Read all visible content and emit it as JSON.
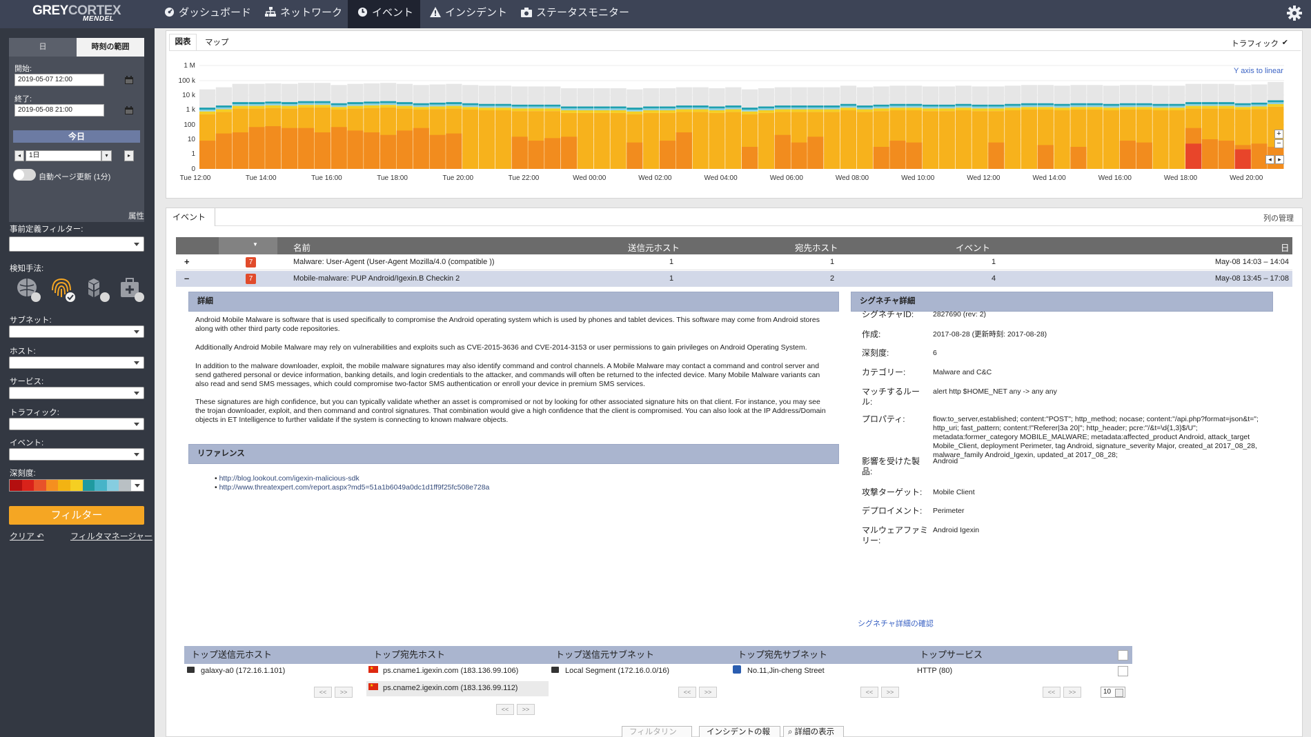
{
  "brand": {
    "name_a": "GREY",
    "name_b": "CORTEX",
    "sub": "MENDEL"
  },
  "nav": [
    {
      "label": "ダッシュボード",
      "icon": "dashboard-icon"
    },
    {
      "label": "ネットワーク",
      "icon": "network-icon"
    },
    {
      "label": "イベント",
      "icon": "clock-icon",
      "active": true
    },
    {
      "label": "インシデント",
      "icon": "warning-icon"
    },
    {
      "label": "ステータスモニター",
      "icon": "camera-icon"
    }
  ],
  "sidebar": {
    "seg_day": "日",
    "seg_range": "時刻の範囲",
    "start_label": "開始:",
    "start_value": "2019-05-07 12:00",
    "end_label": "終了:",
    "end_value": "2019-05-08 21:00",
    "today": "今日",
    "period_value": "1日",
    "auto_refresh": "自動ページ更新 (1分)",
    "attrs": "属性",
    "predef_filter": "事前定義フィルター:",
    "detection": "検知手法:",
    "subnet": "サブネット:",
    "host": "ホスト:",
    "service": "サービス:",
    "traffic": "トラフィック:",
    "event": "イベント:",
    "severity": "深刻度:",
    "severity_colors": [
      "#b40f0f",
      "#d9221a",
      "#e8522a",
      "#f58f1f",
      "#f3b312",
      "#f5cf22",
      "#1f9aa0",
      "#47b4c8",
      "#86cde0",
      "#b9c0c4"
    ],
    "filter_btn": "フィルター",
    "clear": "クリア",
    "filter_manager": "フィルタマネージャー"
  },
  "chart": {
    "tabs": [
      "図表",
      "マップ"
    ],
    "traffic_toggle": "トラフィック",
    "traffic_check": "✔",
    "yaxis_link": "Y axis to linear",
    "zoom_in": "+",
    "zoom_out": "−",
    "nav_prev": "◂",
    "nav_next": "▸",
    "chart_data": {
      "type": "bar",
      "yscale": "log",
      "ylabels": [
        "1 M",
        "100 k",
        "10 k",
        "1 k",
        "100",
        "10",
        "1",
        "0"
      ],
      "xlabels": [
        "Tue 12:00",
        "Tue 14:00",
        "Tue 16:00",
        "Tue 18:00",
        "Tue 20:00",
        "Tue 22:00",
        "Wed 00:00",
        "Wed 02:00",
        "Wed 04:00",
        "Wed 06:00",
        "Wed 08:00",
        "Wed 10:00",
        "Wed 12:00",
        "Wed 14:00",
        "Wed 16:00",
        "Wed 18:00",
        "Wed 20:00"
      ],
      "bins": 66,
      "grey_top": [
        25000,
        35000,
        60000,
        60000,
        65000,
        60000,
        70000,
        70000,
        50000,
        60000,
        65000,
        70000,
        60000,
        50000,
        55000,
        60000,
        50000,
        45000,
        45000,
        40000,
        40000,
        40000,
        30000,
        30000,
        30000,
        30000,
        25000,
        30000,
        30000,
        35000,
        35000,
        30000,
        35000,
        25000,
        30000,
        35000,
        35000,
        35000,
        35000,
        45000,
        35000,
        40000,
        45000,
        45000,
        40000,
        40000,
        45000,
        40000,
        40000,
        45000,
        50000,
        50000,
        45000,
        50000,
        50000,
        45000,
        50000,
        50000,
        45000,
        45000,
        60000,
        60000,
        60000,
        50000,
        55000,
        80000
      ],
      "dark_orange": [
        8,
        25,
        30,
        70,
        80,
        60,
        60,
        30,
        70,
        40,
        30,
        20,
        40,
        60,
        20,
        25,
        0,
        0,
        0,
        15,
        8,
        12,
        15,
        0,
        0,
        0,
        6,
        0,
        8,
        30,
        0,
        0,
        0,
        3,
        0,
        20,
        6,
        15,
        0,
        0,
        0,
        3,
        8,
        6,
        0,
        0,
        0,
        0,
        6,
        0,
        0,
        4,
        0,
        3,
        0,
        0,
        8,
        6,
        0,
        0,
        60,
        10,
        8,
        4,
        5,
        3
      ],
      "red": [
        0,
        0,
        0,
        0,
        0,
        0,
        0,
        0,
        0,
        0,
        0,
        0,
        0,
        0,
        0,
        0,
        0,
        0,
        0,
        0,
        0,
        0,
        0,
        0,
        0,
        0,
        0,
        0,
        0,
        0,
        0,
        0,
        0,
        0,
        0,
        0,
        0,
        0,
        0,
        0,
        0,
        0,
        0,
        0,
        0,
        0,
        0,
        0,
        0,
        0,
        0,
        0,
        0,
        0,
        0,
        0,
        0,
        0,
        0,
        0,
        5,
        0,
        0,
        2,
        0,
        0
      ]
    }
  },
  "events": {
    "tab": "イベント",
    "manage_cols": "列の管理",
    "columns": {
      "name": "名前",
      "src": "送信元ホスト",
      "dst": "宛先ホスト",
      "events": "イベント",
      "date": "日"
    },
    "rows": [
      {
        "expand": "+",
        "sev": "7",
        "name": "Malware: User-Agent (User-Agent Mozilla/4.0 (compatible ))",
        "src": "1",
        "dst": "1",
        "events": "1",
        "date": "May-08 14:03 – 14:04"
      },
      {
        "expand": "–",
        "sev": "7",
        "name": "Mobile-malware: PUP Android/Igexin.B Checkin 2",
        "src": "1",
        "dst": "2",
        "events": "4",
        "date": "May-08 13:45 – 17:08"
      }
    ],
    "detail_header": "詳細",
    "detail_paras": [
      "Android Mobile Malware is software that is used specifically to compromise the Android operating system which is used by phones and tablet devices. This software may come from Android stores along with other third party code repositories.",
      "Additionally Android Mobile Malware may rely on vulnerabilities and exploits such as CVE-2015-3636 and CVE-2014-3153 or user permissions to gain privileges on Android Operating System.",
      "In addition to the malware downloader, exploit, the mobile malware signatures may also identify command and control channels. A Mobile Malware may contact a command and control server and send gathered personal or device information, banking details, and login credentials to the attacker, and commands will often be returned to the infected device. Many Mobile Malware variants can also read and send SMS messages, which could compromise two-factor SMS authentication or enroll your device in premium SMS services.",
      "These signatures are high confidence, but you can typically validate whether an asset is compromised or not by looking for other associated signature hits on that client. For instance, you may see the trojan downloader, exploit, and then command and control signatures. That combination would give a high confidence that the client is compromised. You can also look at the IP Address/Domain objects in ET Intelligence to further validate if the system is connecting to known malware objects."
    ],
    "ref_header": "リファレンス",
    "refs": [
      "http://blog.lookout.com/igexin-malicious-sdk",
      "http://www.threatexpert.com/report.aspx?md5=51a1b6049a0dc1d1ff9f25fc508e728a"
    ],
    "sig_header": "シグネチャ詳細",
    "sig": [
      {
        "k": "シグネチャID:",
        "v": "2827690 (rev: 2)"
      },
      {
        "k": "作成:",
        "v": "2017-08-28 (更新時刻: 2017-08-28)"
      },
      {
        "k": "深刻度:",
        "v": "6"
      },
      {
        "k": "カテゴリー:",
        "v": "Malware and C&C"
      },
      {
        "k": "マッチするルール:",
        "v": "alert http $HOME_NET any -> any any"
      },
      {
        "k": "プロパティ:",
        "v": "flow:to_server,established; content:\"POST\"; http_method; nocase; content:\"/api.php?format=json&t=\"; http_uri; fast_pattern; content:!\"Referer|3a 20|\"; http_header; pcre:\"/&t=\\d{1,3}$/U\"; metadata:former_category MOBILE_MALWARE; metadata:affected_product Android, attack_target Mobile_Client, deployment Perimeter, tag Android, signature_severity Major, created_at 2017_08_28, malware_family Android_Igexin, updated_at 2017_08_28;"
      },
      {
        "k": "影響を受けた製品:",
        "v": "Android"
      },
      {
        "k": "攻撃ターゲット:",
        "v": "Mobile Client"
      },
      {
        "k": "デプロイメント:",
        "v": "Perimeter"
      },
      {
        "k": "マルウェアファミリー:",
        "v": "Android Igexin"
      }
    ],
    "sig_link": "シグネチャ詳細の確認",
    "boxes": [
      {
        "title": "トップ送信元ホスト",
        "entries": [
          {
            "text": "galaxy-a0 (172.16.1.101)",
            "icon": "host-icon"
          }
        ],
        "page_size": "10"
      },
      {
        "title": "トップ宛先ホスト",
        "entries": [
          {
            "text": "ps.cname1.igexin.com (183.136.99.106)",
            "icon": "cn-flag-icon"
          },
          {
            "text": "ps.cname2.igexin.com (183.136.99.112)",
            "icon": "cn-flag-icon"
          }
        ],
        "page_size": "10"
      },
      {
        "title": "トップ送信元サブネット",
        "entries": [
          {
            "text": "Local Segment (172.16.0.0/16)",
            "icon": "host-icon"
          }
        ],
        "page_size": "10"
      },
      {
        "title": "トップ宛先サブネット",
        "entries": [
          {
            "text": "No.11,Jin-cheng Street",
            "icon": "net-icon"
          }
        ],
        "page_size": "10"
      },
      {
        "title": "トップサービス",
        "entries": [
          {
            "text": "HTTP (80)",
            "icon": ""
          }
        ],
        "page_size": "10"
      }
    ],
    "pager_prev": "<<",
    "pager_next": ">>",
    "bottom_buttons": [
      "フィルタリング用",
      "インシデントの報告",
      "詳細の表示"
    ]
  }
}
